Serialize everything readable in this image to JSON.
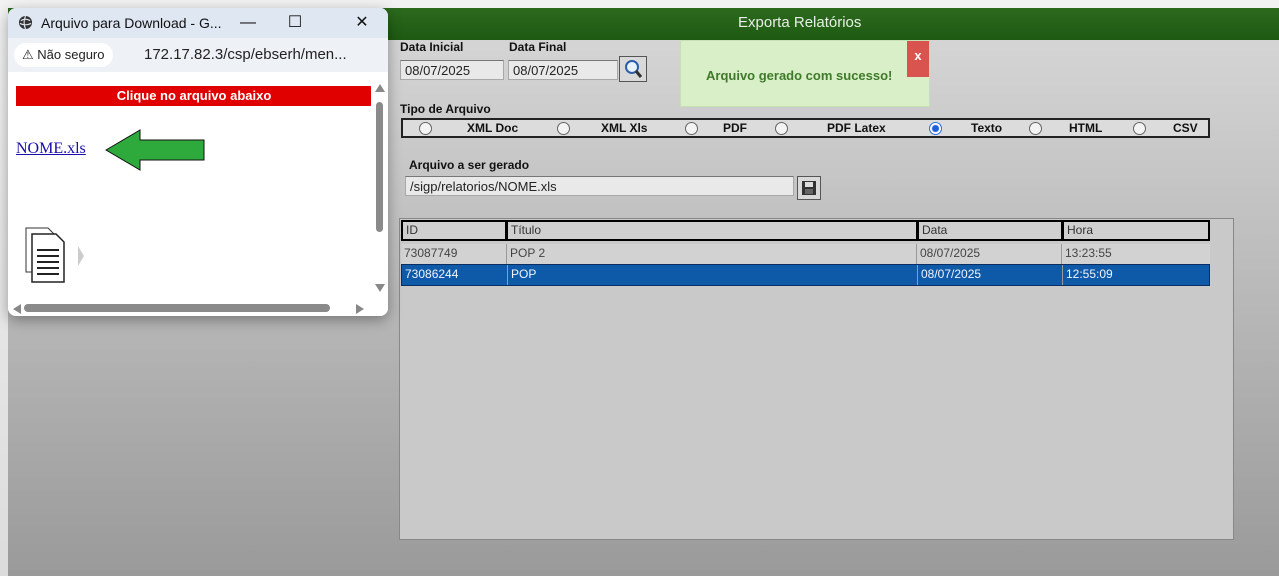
{
  "main": {
    "title": "Exporta Relatórios",
    "data_inicial_label": "Data Inicial",
    "data_final_label": "Data Final",
    "data_inicial": "08/07/2025",
    "data_final": "08/07/2025",
    "tipo_label": "Tipo de Arquivo",
    "tipos": [
      {
        "label": "XML Doc",
        "checked": false
      },
      {
        "label": "XML Xls",
        "checked": false
      },
      {
        "label": "PDF",
        "checked": false
      },
      {
        "label": "PDF Latex",
        "checked": false
      },
      {
        "label": "Texto",
        "checked": true
      },
      {
        "label": "HTML",
        "checked": false
      },
      {
        "label": "CSV",
        "checked": false
      }
    ],
    "arquivo_label": "Arquivo a ser gerado",
    "arquivo_path": "/sigp/relatorios/NOME.xls",
    "table": {
      "headers": [
        "ID",
        "Título",
        "Data",
        "Hora"
      ],
      "rows": [
        [
          "73087749",
          "POP 2",
          "08/07/2025",
          "13:23:55"
        ],
        [
          "73086244",
          "POP",
          "08/07/2025",
          "12:55:09"
        ]
      ],
      "selected_row": 1
    },
    "toast": {
      "text": "Arquivo gerado com sucesso!",
      "close": "x"
    },
    "colors": {
      "header_green": "#2c6a1e",
      "selected_row": "#0f5aa8",
      "toast_bg": "#d9efc8",
      "toast_close": "#d9534f"
    }
  },
  "popup": {
    "title": "Arquivo para Download - G...",
    "security": "Não seguro",
    "url": "172.17.82.3/csp/ebserh/men...",
    "banner": "Clique no arquivo abaixo",
    "file_link": "NOME.xls",
    "controls": {
      "minimize": "—",
      "maximize": "☐",
      "close": "✕"
    },
    "icons": [
      "globe-icon",
      "warning-icon",
      "arrow-left-icon",
      "document-icon"
    ],
    "colors": {
      "banner": "#e10000",
      "arrow": "#2eaa3c"
    }
  }
}
